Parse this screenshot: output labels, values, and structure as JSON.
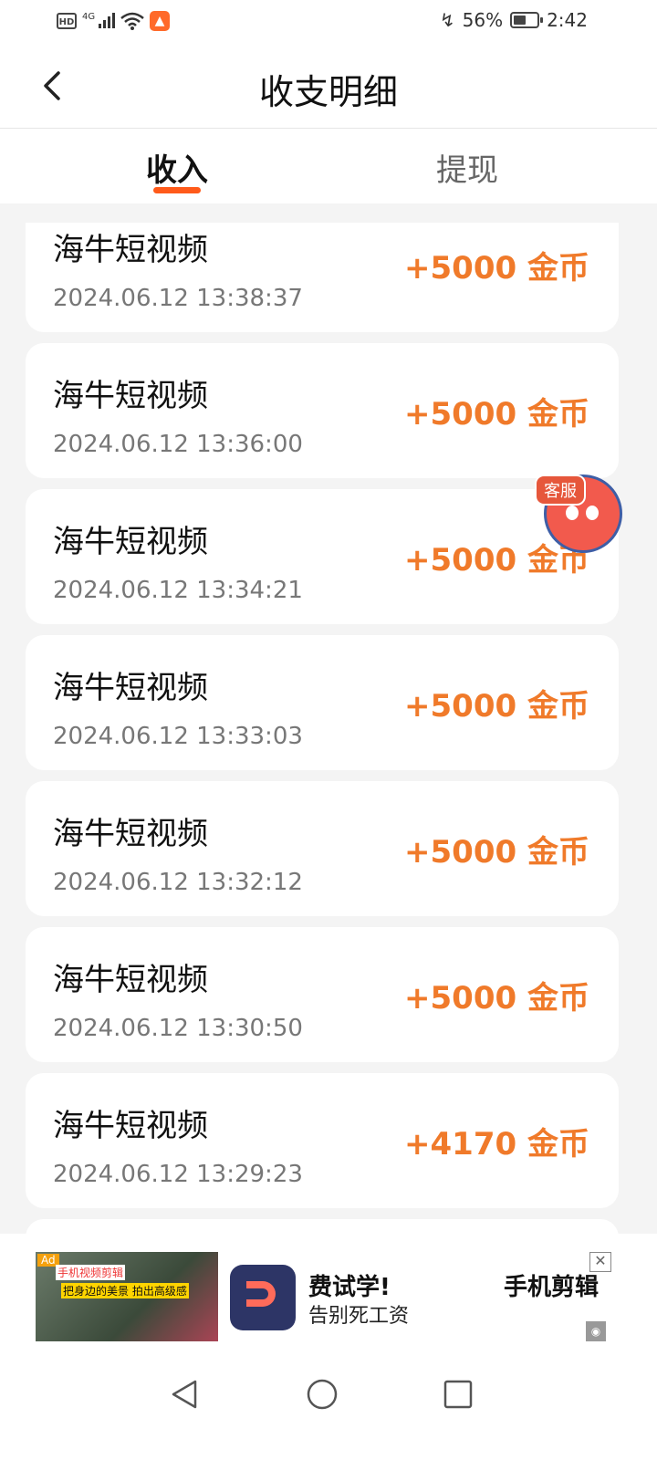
{
  "status": {
    "network": "4G",
    "battery": "56%",
    "battery_level": 0.56,
    "time": "2:42"
  },
  "header": {
    "title": "收支明细"
  },
  "tabs": [
    {
      "label": "收入",
      "active": true
    },
    {
      "label": "提现",
      "active": false
    }
  ],
  "records": [
    {
      "name": "海牛短视频",
      "time": "2024.06.12 13:38:37",
      "amount": "+5000 金币"
    },
    {
      "name": "海牛短视频",
      "time": "2024.06.12 13:36:00",
      "amount": "+5000 金币"
    },
    {
      "name": "海牛短视频",
      "time": "2024.06.12 13:34:21",
      "amount": "+5000 金币"
    },
    {
      "name": "海牛短视频",
      "time": "2024.06.12 13:33:03",
      "amount": "+5000 金币"
    },
    {
      "name": "海牛短视频",
      "time": "2024.06.12 13:32:12",
      "amount": "+5000 金币"
    },
    {
      "name": "海牛短视频",
      "time": "2024.06.12 13:30:50",
      "amount": "+5000 金币"
    },
    {
      "name": "海牛短视频",
      "time": "2024.06.12 13:29:23",
      "amount": "+4170 金币"
    }
  ],
  "support": {
    "label": "客服"
  },
  "ad": {
    "tag": "Ad",
    "image_line1": "手机视频剪辑",
    "image_line2": "把身边的美景 拍出高级感",
    "title": "费试学!",
    "subtitle": "告别死工资",
    "right_text": "手机剪辑"
  },
  "colors": {
    "accent": "#ff5a1a",
    "amount": "#f07a2a"
  }
}
